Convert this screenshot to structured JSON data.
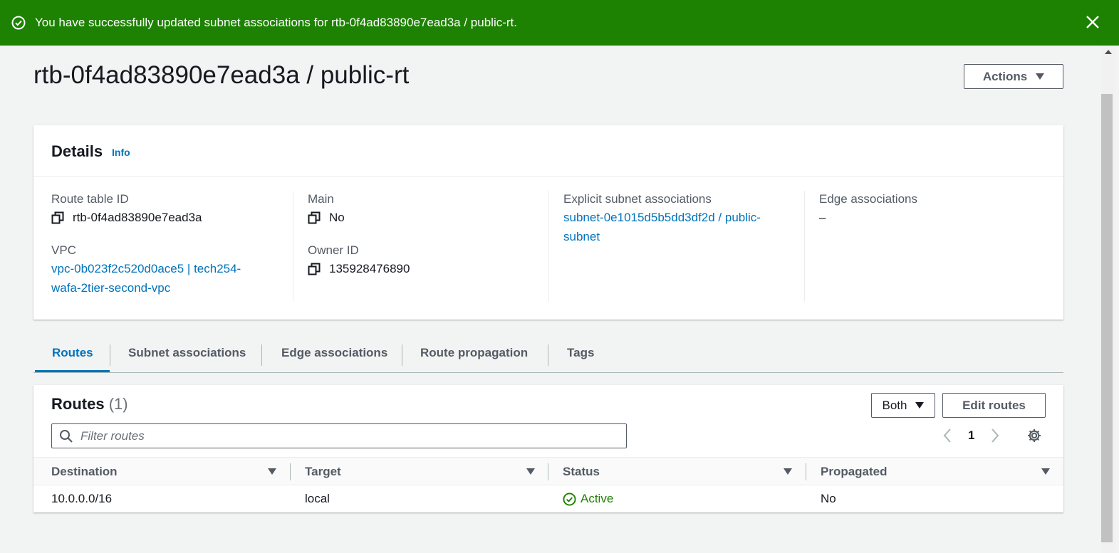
{
  "flash": {
    "message": "You have successfully updated subnet associations for rtb-0f4ad83890e7ead3a / public-rt.",
    "color": "#1d8102"
  },
  "page": {
    "title": "rtb-0f4ad83890e7ead3a / public-rt",
    "actions_label": "Actions"
  },
  "details": {
    "heading": "Details",
    "info_link": "Info",
    "route_table_id_label": "Route table ID",
    "route_table_id": "rtb-0f4ad83890e7ead3a",
    "vpc_label": "VPC",
    "vpc_line1": "vpc-0b023f2c520d0ace5 | tech254-",
    "vpc_line2": "wafa-2tier-second-vpc",
    "main_label": "Main",
    "main": "No",
    "owner_label": "Owner ID",
    "owner_id": "135928476890",
    "explicit_label": "Explicit subnet associations",
    "explicit_line1": "subnet-0e1015d5b5dd3df2d / public-",
    "explicit_line2": "subnet",
    "edge_label": "Edge associations",
    "edge_value": "–"
  },
  "tabs": [
    {
      "label": "Routes",
      "active": true
    },
    {
      "label": "Subnet associations"
    },
    {
      "label": "Edge associations"
    },
    {
      "label": "Route propagation"
    },
    {
      "label": "Tags"
    }
  ],
  "routes": {
    "title": "Routes",
    "count": "(1)",
    "filter_value": "Both",
    "edit_label": "Edit routes",
    "search_placeholder": "Filter routes",
    "page_number": "1",
    "columns": [
      "Destination",
      "Target",
      "Status",
      "Propagated"
    ],
    "rows": [
      {
        "destination": "10.0.0.0/16",
        "target": "local",
        "status": "Active",
        "propagated": "No"
      }
    ]
  },
  "colors": {
    "link": "#0073bb",
    "success": "#1d8102"
  }
}
